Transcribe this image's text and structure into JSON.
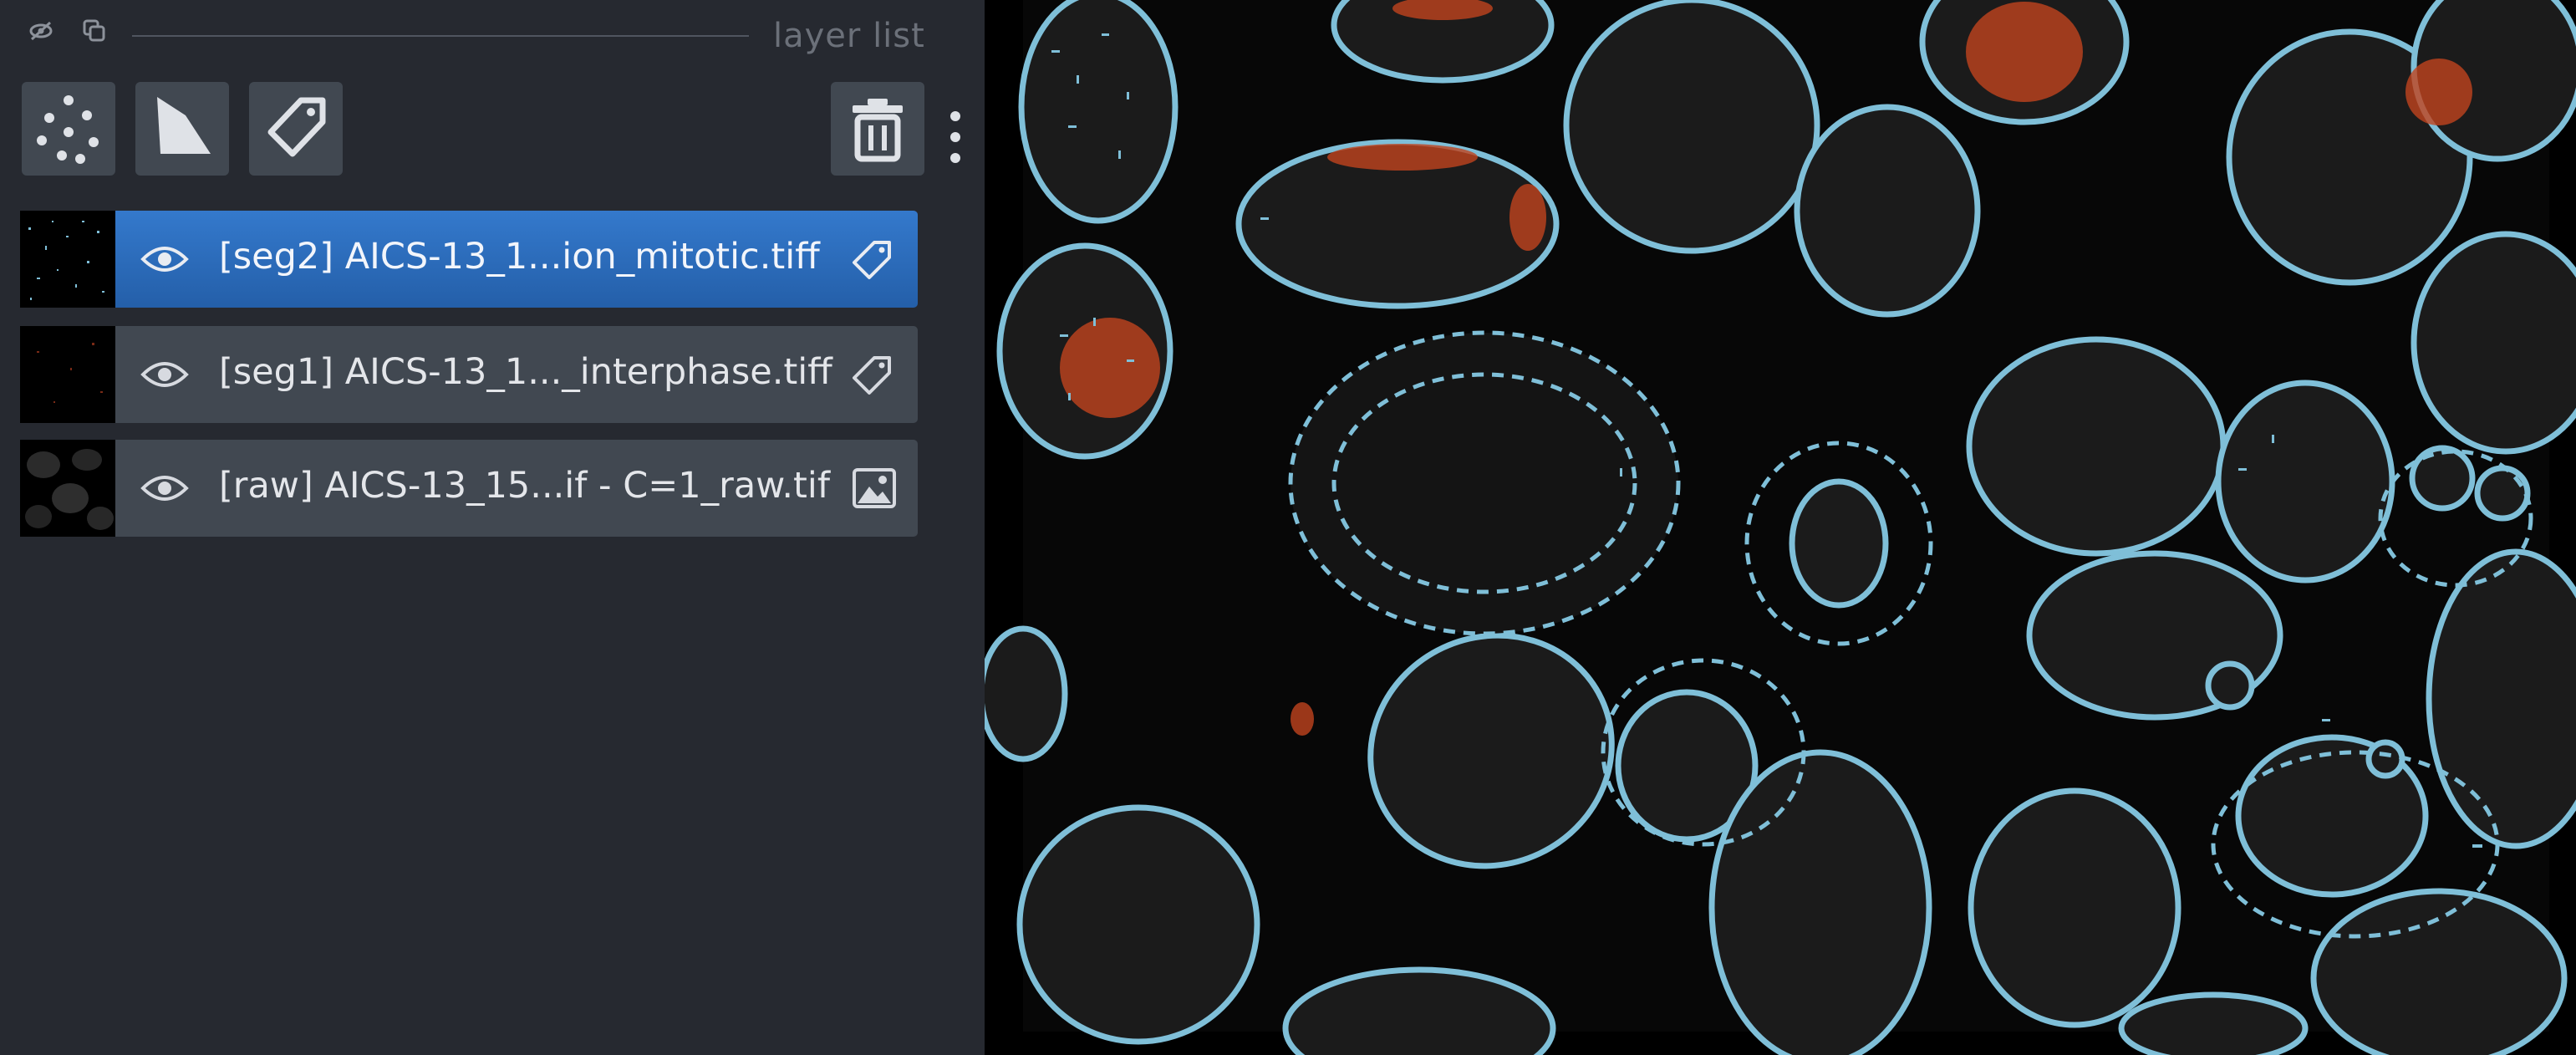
{
  "layer_list": {
    "title": "layer list",
    "header_icons": [
      "visibility-toggle-icon",
      "duplicate-icon"
    ],
    "toolbar": {
      "buttons": [
        {
          "name": "new-points-layer-button",
          "icon": "points-icon"
        },
        {
          "name": "new-shapes-layer-button",
          "icon": "shapes-icon"
        },
        {
          "name": "new-labels-layer-button",
          "icon": "label-tag-icon"
        }
      ],
      "delete_button_icon": "trash-icon",
      "menu_icon": "kebab-menu-icon"
    },
    "layers": [
      {
        "name": "[seg2] AICS-13_1...ion_mitotic.tiff",
        "type": "labels",
        "type_icon": "label-tag-icon",
        "visible": true,
        "selected": true
      },
      {
        "name": "[seg1] AICS-13_1..._interphase.tiff",
        "type": "labels",
        "type_icon": "label-tag-icon",
        "visible": true,
        "selected": false
      },
      {
        "name": "[raw] AICS-13_15...if - C=1_raw.tif",
        "type": "image",
        "type_icon": "image-icon",
        "visible": true,
        "selected": false
      }
    ]
  },
  "canvas": {
    "content": "microscopy-image-with-cell-outlines",
    "colors": {
      "background": "#000000",
      "contour": "#7fbfd8",
      "mitotic_label": "#c0431e",
      "nucleus_fill": "#1b1b1b"
    }
  },
  "colors": {
    "panel_background": "#262930",
    "button_background": "#414851",
    "selected_layer": "#2f6fc0"
  }
}
